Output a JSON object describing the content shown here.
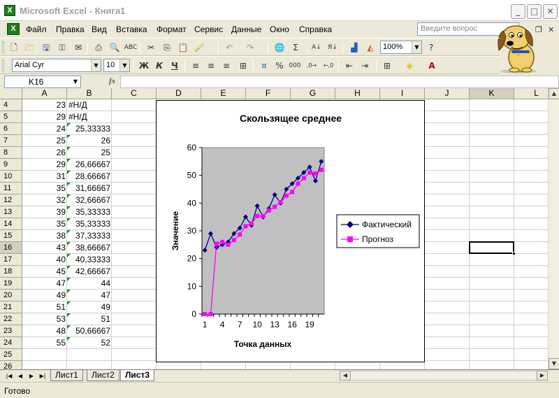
{
  "window": {
    "title": "Microsoft Excel - Книга1"
  },
  "menu": [
    "Файл",
    "Правка",
    "Вид",
    "Вставка",
    "Формат",
    "Сервис",
    "Данные",
    "Окно",
    "Справка"
  ],
  "help_search": {
    "placeholder": "Введите вопрос"
  },
  "toolbar": {
    "zoom": "100%",
    "font_name": "Arial Cyr",
    "font_size": "10",
    "bold": "Ж",
    "italic": "К",
    "underline": "Ч",
    "percent": "%",
    "thousands": "000",
    "autosum": "Σ"
  },
  "formula_bar": {
    "name_box": "K16",
    "fx": "fx",
    "formula": ""
  },
  "columns": [
    "A",
    "B",
    "C",
    "D",
    "E",
    "F",
    "G",
    "H",
    "I",
    "J",
    "K",
    "L"
  ],
  "rows": [
    {
      "n": "4",
      "a": "23",
      "b": "#Н/Д"
    },
    {
      "n": "5",
      "a": "29",
      "b": "#Н/Д"
    },
    {
      "n": "6",
      "a": "24",
      "b": "25,33333"
    },
    {
      "n": "7",
      "a": "25",
      "b": "26"
    },
    {
      "n": "8",
      "a": "26",
      "b": "25"
    },
    {
      "n": "9",
      "a": "29",
      "b": "26,66667"
    },
    {
      "n": "10",
      "a": "31",
      "b": "28,66667"
    },
    {
      "n": "11",
      "a": "35",
      "b": "31,66667"
    },
    {
      "n": "12",
      "a": "32",
      "b": "32,66667"
    },
    {
      "n": "13",
      "a": "39",
      "b": "35,33333"
    },
    {
      "n": "14",
      "a": "35",
      "b": "35,33333"
    },
    {
      "n": "15",
      "a": "38",
      "b": "37,33333"
    },
    {
      "n": "16",
      "a": "43",
      "b": "38,66667"
    },
    {
      "n": "17",
      "a": "40",
      "b": "40,33333"
    },
    {
      "n": "18",
      "a": "45",
      "b": "42,66667"
    },
    {
      "n": "19",
      "a": "47",
      "b": "44"
    },
    {
      "n": "20",
      "a": "49",
      "b": "47"
    },
    {
      "n": "21",
      "a": "51",
      "b": "49"
    },
    {
      "n": "22",
      "a": "53",
      "b": "51"
    },
    {
      "n": "23",
      "a": "48",
      "b": "50,66667"
    },
    {
      "n": "24",
      "a": "55",
      "b": "52"
    },
    {
      "n": "25",
      "a": "",
      "b": ""
    },
    {
      "n": "26",
      "a": "",
      "b": ""
    }
  ],
  "sheets": [
    "Лист1",
    "Лист2",
    "Лист3"
  ],
  "active_sheet": "Лист3",
  "status": "Готово",
  "chart_data": {
    "type": "line",
    "title": "Скользящее среднее",
    "xlabel": "Точка данных",
    "ylabel": "Значение",
    "x": [
      1,
      2,
      3,
      4,
      5,
      6,
      7,
      8,
      9,
      10,
      11,
      12,
      13,
      14,
      15,
      16,
      17,
      18,
      19,
      20,
      21
    ],
    "xticks": [
      "1",
      "4",
      "7",
      "10",
      "13",
      "16",
      "19"
    ],
    "yticks": [
      "0",
      "10",
      "20",
      "30",
      "40",
      "50",
      "60"
    ],
    "ylim": [
      0,
      60
    ],
    "grid": false,
    "legend": "right",
    "series": [
      {
        "name": "Фактический",
        "color": "#000080",
        "marker": "diamond",
        "values": [
          23,
          29,
          24,
          25,
          26,
          29,
          31,
          35,
          32,
          39,
          35,
          38,
          43,
          40,
          45,
          47,
          49,
          51,
          53,
          48,
          55
        ]
      },
      {
        "name": "Прогноз",
        "color": "#ff00ff",
        "marker": "square",
        "values": [
          0,
          0,
          25.33333,
          26,
          25,
          26.66667,
          28.66667,
          31.66667,
          32.66667,
          35.33333,
          35.33333,
          37.33333,
          38.66667,
          40.33333,
          42.66667,
          44,
          47,
          49,
          51,
          50.66667,
          52
        ]
      }
    ]
  }
}
